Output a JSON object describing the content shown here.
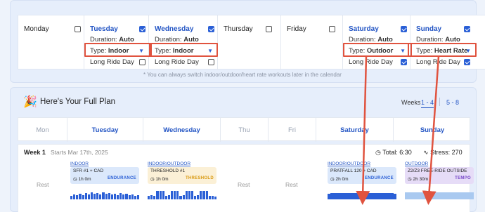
{
  "settings": {
    "days": [
      {
        "name": "Monday",
        "active": false
      },
      {
        "name": "Tuesday",
        "active": true,
        "duration_label": "Duration:",
        "duration_value": "Auto",
        "type_label": "Type:",
        "type_value": "Indoor",
        "long_ride": "Long Ride Day",
        "long_ride_on": false
      },
      {
        "name": "Wednesday",
        "active": true,
        "duration_label": "Duration:",
        "duration_value": "Auto",
        "type_label": "Type:",
        "type_value": "Indoor",
        "long_ride": "Long Ride Day",
        "long_ride_on": false
      },
      {
        "name": "Thursday",
        "active": false
      },
      {
        "name": "Friday",
        "active": false
      },
      {
        "name": "Saturday",
        "active": true,
        "duration_label": "Duration:",
        "duration_value": "Auto",
        "type_label": "Type:",
        "type_value": "Outdoor",
        "long_ride": "Long Ride Day",
        "long_ride_on": true
      },
      {
        "name": "Sunday",
        "active": true,
        "duration_label": "Duration:",
        "duration_value": "Auto",
        "type_label": "Type:",
        "type_value": "Heart Rate",
        "long_ride": "Long Ride Day",
        "long_ride_on": true
      }
    ],
    "hint": "* You can always switch indoor/outdoor/heart rate workouts later in the calendar"
  },
  "plan": {
    "title": "Here's Your Full Plan",
    "weeks_label": "Weeks",
    "week_tabs": [
      "1 - 4",
      "5 - 8"
    ],
    "columns": [
      "Mon",
      "Tuesday",
      "Wednesday",
      "Thu",
      "Fri",
      "Saturday",
      "Sunday"
    ],
    "week": {
      "label": "Week 1",
      "starts": "Starts Mar 17th, 2025",
      "total": "Total: 6:30",
      "stress": "Stress: 270",
      "rest_label": "Rest",
      "workouts": {
        "tuesday": {
          "type": "INDOOR",
          "name": "SFR #1 + CAD",
          "duration": "1h 0m",
          "zone": "ENDURANCE",
          "bg": "#dbe8fb",
          "zone_color": "#2a5fd6"
        },
        "wednesday": {
          "type": "INDOOR/OUTDOOR",
          "name": "THRESHOLD #1",
          "duration": "1h 0m",
          "zone": "THRESHOLD",
          "bg": "#fbf0d6",
          "zone_color": "#d99a12"
        },
        "saturday": {
          "type": "INDOOR/OUTDOOR",
          "name": "PRATFALL 120 + CAD",
          "duration": "2h 0m",
          "zone": "ENDURANCE",
          "bg": "#dbe8fb",
          "zone_color": "#2a5fd6"
        },
        "sunday": {
          "type": "OUTDOOR",
          "name": "Z2/Z3 FREE-RIDE OUTSIDE",
          "duration": "2h 30m",
          "zone": "TEMPO",
          "bg": "#e6dcf7",
          "zone_color": "#7a4bc9"
        }
      }
    }
  },
  "colors": {
    "accent": "#2355c4",
    "highlight": "#e0533f"
  }
}
